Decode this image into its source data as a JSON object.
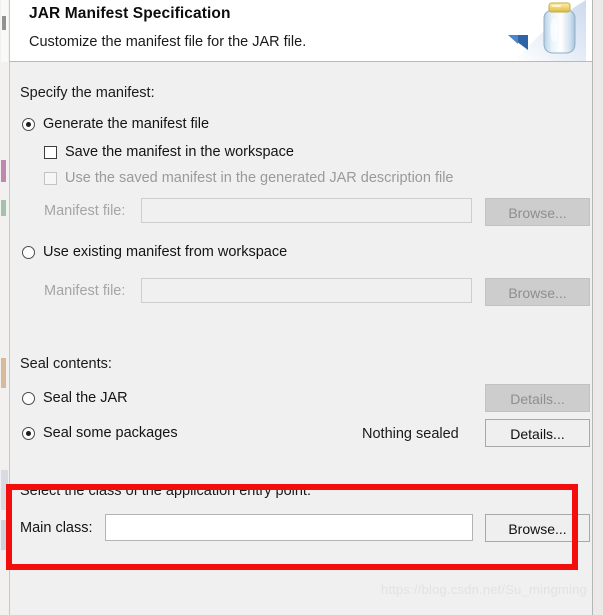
{
  "window": {
    "title": "JAR Manifest Specification",
    "description": "Customize the manifest file for the JAR file.",
    "icon": "jar-file-icon"
  },
  "manifest_section": {
    "label": "Specify the manifest:",
    "options": [
      {
        "id": "generate-manifest",
        "label": "Generate the manifest file",
        "type": "radio",
        "checked": true,
        "enabled": true
      },
      {
        "id": "save-manifest-workspace",
        "label": "Save the manifest in the workspace",
        "type": "checkbox",
        "checked": false,
        "enabled": true
      },
      {
        "id": "use-saved-manifest",
        "label": "Use the saved manifest in the generated JAR description file",
        "type": "checkbox",
        "checked": false,
        "enabled": false
      },
      {
        "id": "use-existing-manifest",
        "label": "Use existing manifest from workspace",
        "type": "radio",
        "checked": false,
        "enabled": true
      }
    ],
    "manifest_file_generated": {
      "label": "Manifest file:",
      "value": "",
      "placeholder": "",
      "enabled": false,
      "browse_label": "Browse...",
      "browse_enabled": false
    },
    "manifest_file_existing": {
      "label": "Manifest file:",
      "value": "",
      "placeholder": "",
      "enabled": false,
      "browse_label": "Browse...",
      "browse_enabled": false
    }
  },
  "seal_section": {
    "label": "Seal contents:",
    "seal_jar": {
      "label": "Seal the JAR",
      "checked": false,
      "details_label": "Details...",
      "details_enabled": false
    },
    "seal_some": {
      "label": "Seal some packages",
      "checked": true,
      "status": "Nothing sealed",
      "details_label": "Details...",
      "details_enabled": true
    }
  },
  "entry_point_section": {
    "label": "Select the class of the application entry point:",
    "main_class": {
      "label": "Main class:",
      "value": "",
      "placeholder": "",
      "browse_label": "Browse...",
      "browse_enabled": true
    },
    "highlight_color": "#f40d0d"
  },
  "watermark": {
    "text": "https://blog.csdn.net/Su_mingming"
  }
}
